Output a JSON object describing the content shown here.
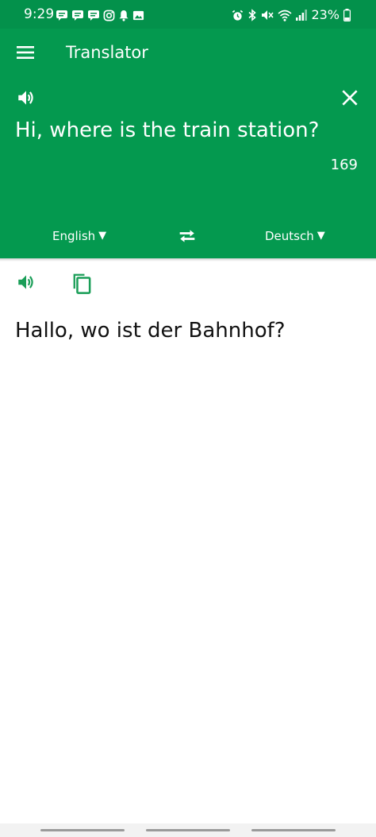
{
  "status_bar": {
    "time": "9:29",
    "battery": "23%",
    "icons_left": [
      "message-icon",
      "message-icon",
      "message-icon",
      "instagram-icon",
      "bell-icon",
      "gallery-icon"
    ],
    "icons_right": [
      "alarm-icon",
      "bluetooth-icon",
      "mute-icon",
      "wifi-icon",
      "signal-icon",
      "battery-icon"
    ]
  },
  "app_bar": {
    "title": "Translator",
    "menu_icon": "menu-icon"
  },
  "source_panel": {
    "text": "Hi, where is the train station?",
    "char_count": "169",
    "speaker_icon": "speaker-icon",
    "clear_icon": "close-icon"
  },
  "languages": {
    "source": "English",
    "target": "Deutsch",
    "caret": "▼",
    "swap_icon": "swap-icon"
  },
  "result_panel": {
    "text": "Hallo, wo ist der Bahnhof?",
    "speaker_icon": "speaker-icon",
    "copy_icon": "copy-icon"
  },
  "colors": {
    "brand_green": "#04994f",
    "status_green": "#03914b",
    "accent_green": "#1a9e58"
  }
}
